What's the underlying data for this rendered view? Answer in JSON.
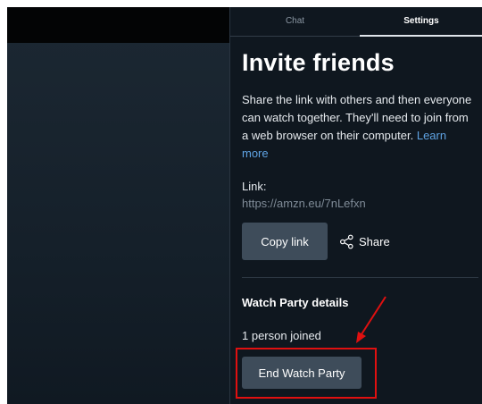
{
  "tabs": [
    {
      "label": "Chat",
      "active": false
    },
    {
      "label": "Settings",
      "active": true
    }
  ],
  "invite": {
    "title": "Invite friends",
    "description": "Share the link with others and then everyone can watch together. They'll need to join from a web browser on their computer.",
    "learn_more": "Learn more",
    "link_label": "Link:",
    "link_url": "https://amzn.eu/7nLefxn",
    "copy_button": "Copy link",
    "share_button": "Share",
    "share_icon": "share-icon"
  },
  "details": {
    "title": "Watch Party details",
    "joined": "1 person joined",
    "end_button": "End Watch Party"
  },
  "colors": {
    "panel_bg": "#0f171f",
    "button_bg": "#3e4c5a",
    "link": "#5fa3e3",
    "annotation": "#e01010"
  }
}
